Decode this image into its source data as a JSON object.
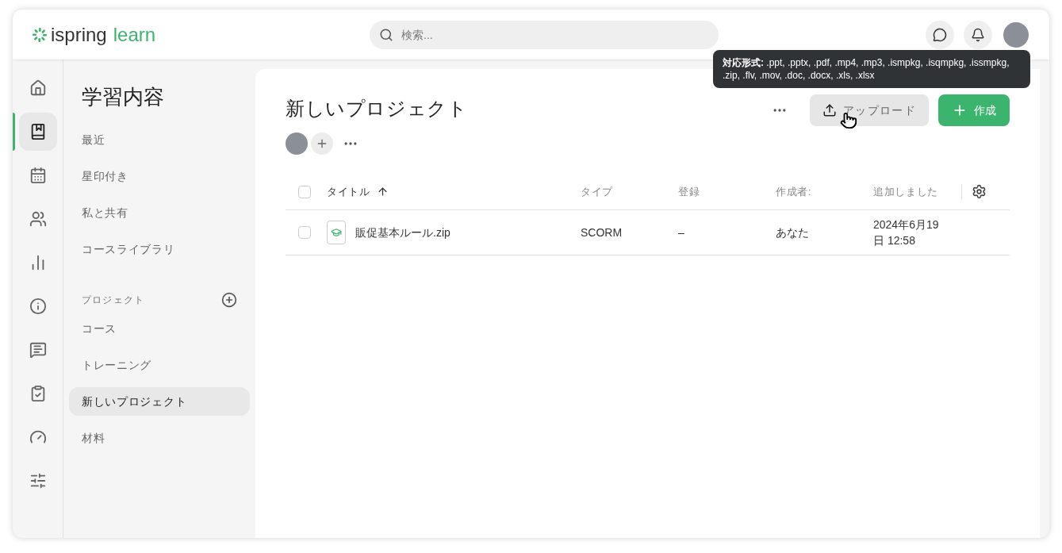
{
  "header": {
    "logo": {
      "brand": "ispring",
      "product": "learn"
    },
    "search": {
      "placeholder": "検索..."
    }
  },
  "rail": [
    {
      "selected": false
    },
    {
      "selected": true
    },
    {
      "selected": false
    },
    {
      "selected": false
    },
    {
      "selected": false
    },
    {
      "selected": false
    },
    {
      "selected": false
    },
    {
      "selected": false
    },
    {
      "selected": false
    },
    {
      "selected": false
    }
  ],
  "sidebar": {
    "title": "学習内容",
    "items": [
      {
        "label": "最近",
        "selected": false
      },
      {
        "label": "星印付き",
        "selected": false
      },
      {
        "label": "私と共有",
        "selected": false
      },
      {
        "label": "コースライブラリ",
        "selected": false
      }
    ],
    "section": "プロジェクト",
    "projects": [
      {
        "label": "コース",
        "selected": false
      },
      {
        "label": "トレーニング",
        "selected": false
      },
      {
        "label": "新しいプロジェクト",
        "selected": true
      },
      {
        "label": "材料",
        "selected": false
      }
    ]
  },
  "main": {
    "title": "新しいプロジェクト",
    "upload_button": "アップロード",
    "create_button": "作成",
    "tooltip": {
      "label": "対応形式:",
      "text": ".ppt, .pptx, .pdf, .mp4, .mp3, .ismpkg, .isqmpkg, .issmpkg, .zip, .flv, .mov, .doc, .docx, .xls, .xlsx"
    },
    "table": {
      "all_checked": false,
      "columns": [
        "タイトル",
        "タイプ",
        "登録",
        "作成者:",
        "追加しました"
      ],
      "rows": [
        {
          "checked": false,
          "title": "販促基本ルール.zip",
          "type": "SCORM",
          "enrollment": "–",
          "author": "あなた",
          "added": "2024年6月19日 12:58"
        }
      ]
    }
  }
}
